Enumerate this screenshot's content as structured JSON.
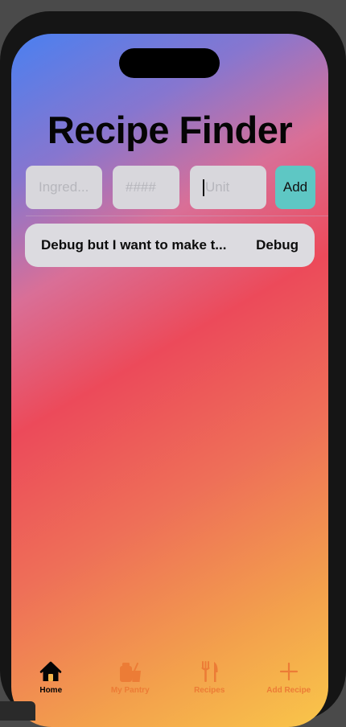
{
  "app": {
    "title": "Recipe Finder"
  },
  "form": {
    "ingredient_placeholder": "Ingred...",
    "quantity_placeholder": "####",
    "unit_placeholder": "Unit",
    "add_label": "Add"
  },
  "list": {
    "items": [
      {
        "text": "Debug but I want to make t...",
        "action": "Debug"
      }
    ]
  },
  "tabbar": {
    "tabs": [
      {
        "label": "Home",
        "icon": "house-icon",
        "active": true
      },
      {
        "label": "My Pantry",
        "icon": "pantry-icon",
        "active": false
      },
      {
        "label": "Recipes",
        "icon": "fork-knife-icon",
        "active": false
      },
      {
        "label": "Add Recipe",
        "icon": "plus-icon",
        "active": false
      }
    ]
  },
  "colors": {
    "add_button": "#5ec7c4",
    "tab_active": "#050505",
    "tab_inactive": "#ec7c36",
    "field_background": "#d8d7dc"
  }
}
